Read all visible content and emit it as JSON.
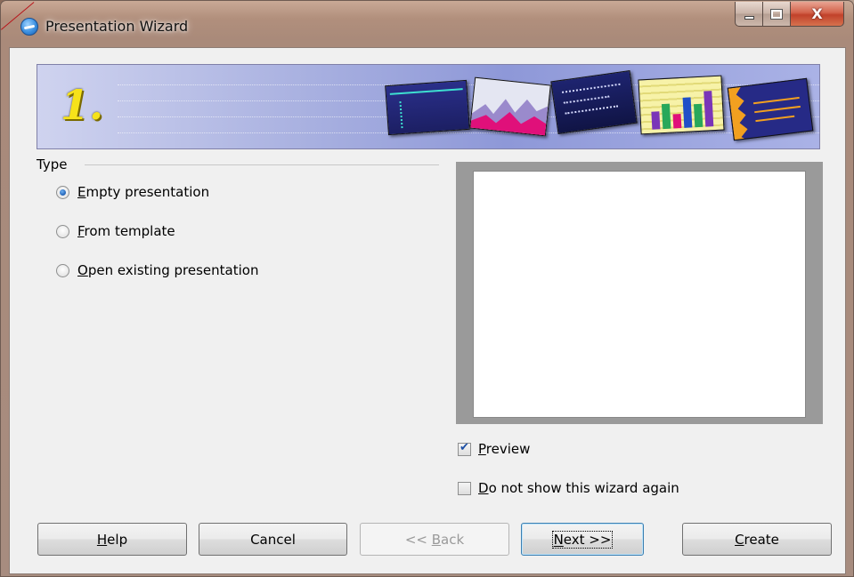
{
  "window": {
    "title": "Presentation Wizard",
    "controls": {
      "minimize": "minimize",
      "maximize": "maximize",
      "close": "X"
    }
  },
  "banner": {
    "step": "1."
  },
  "type_section": {
    "label": "Type",
    "options": [
      {
        "label": "Empty presentation",
        "accel": "E",
        "rest": "mpty presentation",
        "checked": true
      },
      {
        "label": "From template",
        "accel": "F",
        "rest": "rom template",
        "checked": false
      },
      {
        "label": "Open existing presentation",
        "accel": "O",
        "rest": "pen existing presentation",
        "checked": false
      }
    ]
  },
  "options": {
    "preview": {
      "label": "Preview",
      "accel": "P",
      "rest": "review",
      "checked": true
    },
    "do_not_show": {
      "label": "Do not show this wizard again",
      "accel": "D",
      "rest": "o not show this wizard again",
      "checked": false
    }
  },
  "buttons": {
    "help": {
      "label": "Help",
      "pre": "",
      "accel": "H",
      "rest": "elp"
    },
    "cancel": {
      "label": "Cancel"
    },
    "back": {
      "label": "<< Back",
      "pre": "<< ",
      "accel": "B",
      "rest": "ack",
      "disabled": true
    },
    "next": {
      "label": "Next >>",
      "pre": "",
      "accel": "N",
      "rest": "ext >>",
      "default": true
    },
    "create": {
      "label": "Create",
      "pre": "",
      "accel": "C",
      "rest": "reate"
    }
  },
  "colors": {
    "banner_bg": "#a8b0e0",
    "step_number": "#f6e21a",
    "radio_selected": "#1f5fb4",
    "close_button": "#c1412a"
  }
}
